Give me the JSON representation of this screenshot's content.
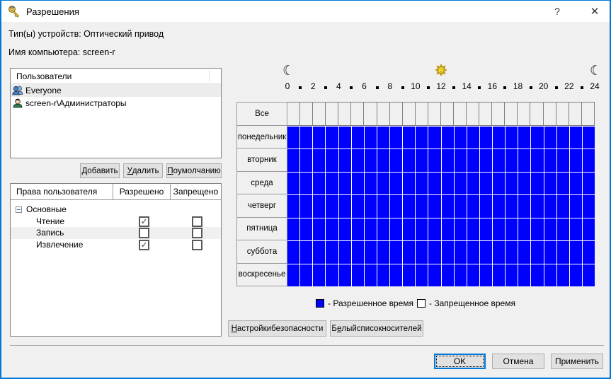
{
  "window": {
    "title": "Разрешения",
    "help_glyph": "?",
    "close_glyph": "✕"
  },
  "header": {
    "device_type_label": "Тип(ы) устройств: Оптический привод",
    "computer_name_label": "Имя компьютера: screen-r"
  },
  "users": {
    "column_header": "Пользователи",
    "items": [
      {
        "name": "Everyone",
        "icon": "group",
        "selected": true
      },
      {
        "name": "screen-r\\Администраторы",
        "icon": "user",
        "selected": false
      }
    ],
    "buttons": {
      "add": {
        "label": "Добавить",
        "accel": 0
      },
      "remove": {
        "label": "Удалить",
        "accel": 0
      },
      "default": {
        "label": "По умолчанию",
        "accel": 0
      }
    }
  },
  "rights": {
    "columns": {
      "name": "Права пользователя",
      "allowed": "Разрешено",
      "denied": "Запрещено"
    },
    "group_label": "Основные",
    "rows": [
      {
        "name": "Чтение",
        "allowed": true,
        "denied": false,
        "highlight": false
      },
      {
        "name": "Запись",
        "allowed": false,
        "denied": false,
        "highlight": true
      },
      {
        "name": "Извлечение",
        "allowed": true,
        "denied": false,
        "highlight": false
      }
    ],
    "check_glyph": "✓"
  },
  "schedule": {
    "hour_labels": [
      "0",
      "2",
      "4",
      "6",
      "8",
      "10",
      "12",
      "14",
      "16",
      "18",
      "20",
      "22",
      "24"
    ],
    "all_row_label": "Все",
    "days": [
      "понедельник",
      "вторник",
      "среда",
      "четверг",
      "пятница",
      "суббота",
      "воскресенье"
    ],
    "columns_per_row": 24,
    "allowed_color": "#0000ff",
    "legend": {
      "allowed_label": "- Разрешенное время",
      "denied_label": "- Запрещенное время"
    }
  },
  "actions": {
    "security": {
      "label": "Настройки безопасности",
      "accel": 0
    },
    "whitelist": {
      "label": "Белый список носителей",
      "accel": 1
    },
    "ok": {
      "label": "OK",
      "accel": -1
    },
    "cancel": {
      "label": "Отмена",
      "accel": -1
    },
    "apply": {
      "label": "Применить",
      "accel": -1
    }
  },
  "colors": {
    "window_border": "#0078d7",
    "dialog_bg": "#f0f0f0",
    "allowed_blue": "#0000ff"
  }
}
